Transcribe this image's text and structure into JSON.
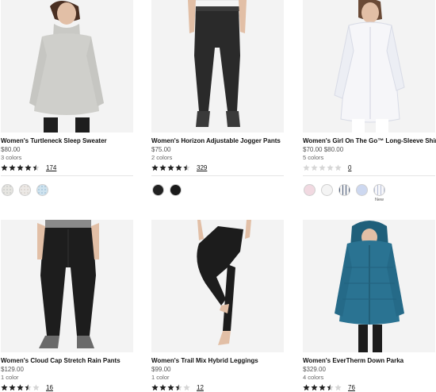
{
  "products": [
    {
      "name": "Women's Turtleneck Sleep Sweater",
      "price": "$80.00",
      "colors": "3 colors",
      "rating": 4.5,
      "review_count": "174",
      "image_icon": "turtleneck-sweater-photo",
      "swatches": [
        {
          "color": "#e6e5e1",
          "pattern": "dots",
          "accent": "#9aa3a1",
          "note": ""
        },
        {
          "color": "#ece9e6",
          "pattern": "dots",
          "accent": "#b9a9a0",
          "note": ""
        },
        {
          "color": "#cfe3ef",
          "pattern": "dots",
          "accent": "#5a8db1",
          "note": ""
        }
      ]
    },
    {
      "name": "Women's Horizon Adjustable Jogger Pants",
      "price": "$75.00",
      "colors": "2 colors",
      "rating": 4.5,
      "review_count": "329",
      "image_icon": "jogger-pants-photo",
      "swatches": [
        {
          "color": "#222222",
          "pattern": "solid",
          "accent": "#222222",
          "note": ""
        },
        {
          "color": "#1a1a1a",
          "pattern": "solid",
          "accent": "#1a1a1a",
          "note": ""
        }
      ]
    },
    {
      "name": "Women's Girl On The Go™ Long-Sleeve Shirt",
      "price": "$70.00 $80.00",
      "colors": "5 colors",
      "rating": 0,
      "review_count": "0",
      "image_icon": "long-sleeve-shirt-photo",
      "swatches": [
        {
          "color": "#f1d9e1",
          "pattern": "solid",
          "accent": "#f1d9e1",
          "note": ""
        },
        {
          "color": "#f4f4f4",
          "pattern": "solid",
          "accent": "#f4f4f4",
          "note": ""
        },
        {
          "color": "#f3f3f3",
          "pattern": "stripes",
          "accent": "#4a5b78",
          "note": ""
        },
        {
          "color": "#cdd8f0",
          "pattern": "solid",
          "accent": "#cdd8f0",
          "note": ""
        },
        {
          "color": "#f7f7fa",
          "pattern": "stripes",
          "accent": "#b6bfd6",
          "note": "New"
        }
      ]
    },
    {
      "name": "Women's Cloud Cap Stretch Rain Pants",
      "price": "$129.00",
      "colors": "1 color",
      "rating": 3.5,
      "review_count": "16",
      "image_icon": "rain-pants-photo",
      "swatches": []
    },
    {
      "name": "Women's Trail Mix Hybrid Leggings",
      "price": "$99.00",
      "colors": "1 color",
      "rating": 3.5,
      "review_count": "12",
      "image_icon": "leggings-photo",
      "swatches": []
    },
    {
      "name": "Women's EverTherm Down Parka",
      "price": "$329.00",
      "colors": "4 colors",
      "rating": 3.5,
      "review_count": "76",
      "image_icon": "down-parka-photo",
      "swatches": []
    }
  ]
}
